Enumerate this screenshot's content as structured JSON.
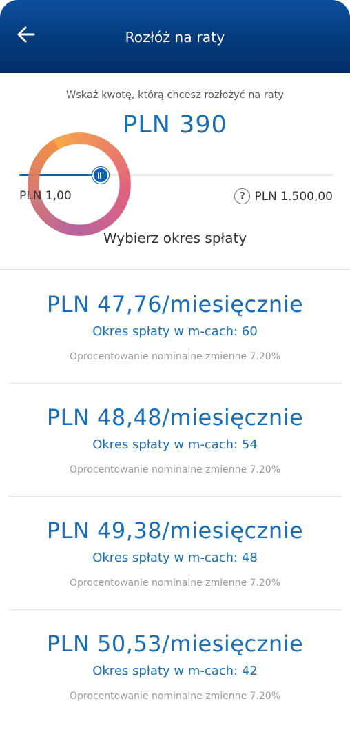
{
  "header": {
    "title": "Rozłóż na raty",
    "back_icon": "arrow-left-icon",
    "background": "#053a7c"
  },
  "amount_selector": {
    "prompt": "Wskaż kwotę, którą chcesz rozłożyć na raty",
    "amount": "PLN 390",
    "min_label": "PLN 1,00",
    "max_label": "PLN 1.500,00",
    "help_icon": "question-circle-icon",
    "help_glyph": "?",
    "min_value": 1,
    "max_value": 1500,
    "value": 390,
    "accent": "#0a61b0"
  },
  "period": {
    "title": "Wybierz okres spłaty",
    "options": [
      {
        "amount": "PLN 47,76/miesięcznie",
        "period": "Okres spłaty w m-cach: 60",
        "rate": "Oprocentowanie nominalne zmienne 7.20%"
      },
      {
        "amount": "PLN 48,48/miesięcznie",
        "period": "Okres spłaty w m-cach: 54",
        "rate": "Oprocentowanie nominalne zmienne 7.20%"
      },
      {
        "amount": "PLN 49,38/miesięcznie",
        "period": "Okres spłaty w m-cach: 48",
        "rate": "Oprocentowanie nominalne zmienne 7.20%"
      },
      {
        "amount": "PLN 50,53/miesięcznie",
        "period": "Okres spłaty w m-cach: 42",
        "rate": "Oprocentowanie nominalne zmienne 7.20%"
      }
    ]
  }
}
